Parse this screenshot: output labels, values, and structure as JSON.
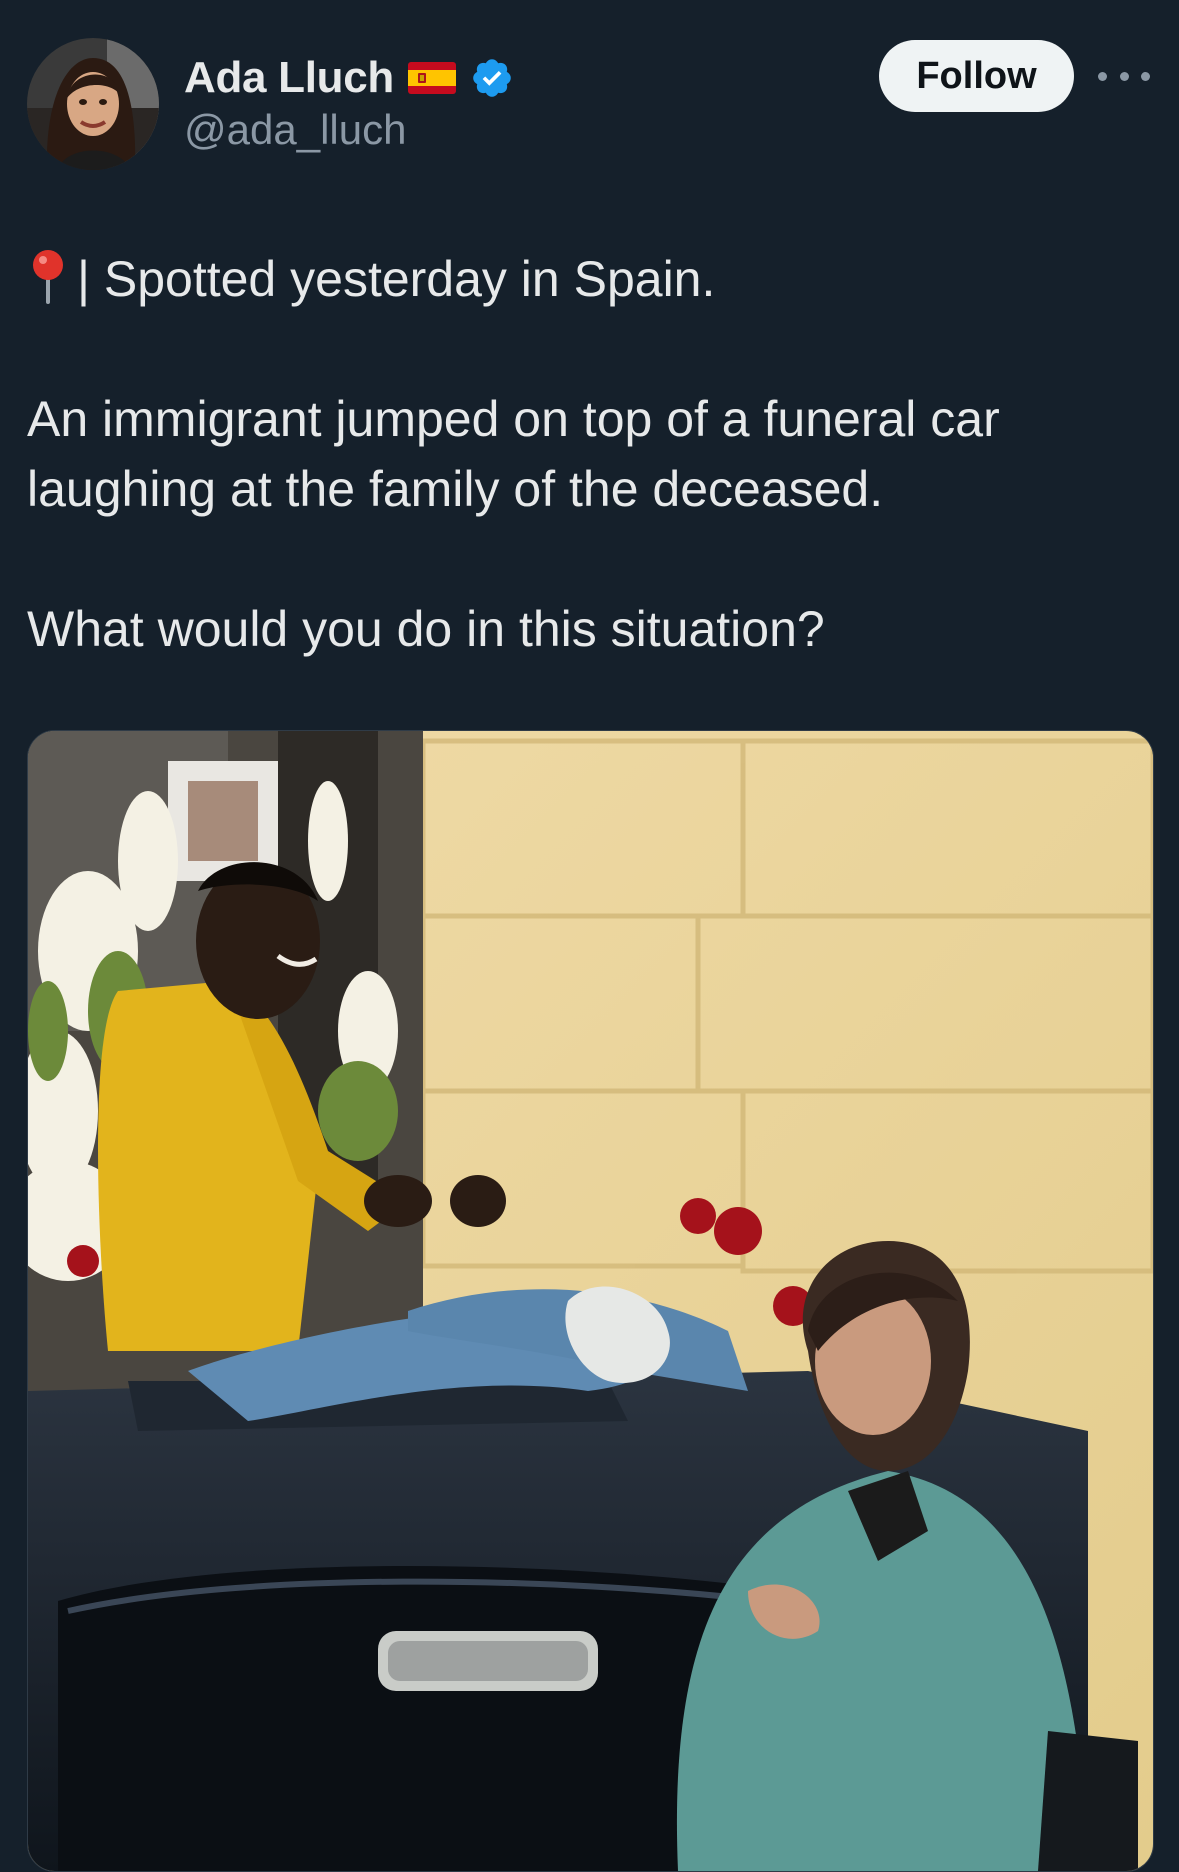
{
  "author": {
    "display_name": "Ada Lluch",
    "handle": "@ada_lluch",
    "flag_icon": "spain-flag-icon",
    "verified_icon": "verified-badge-icon",
    "verified_color": "#1d9bf0"
  },
  "header": {
    "follow_label": "Follow",
    "more_icon": "more-options-icon"
  },
  "tweet": {
    "pin_icon": "round-pushpin-icon",
    "line1": "| Spotted yesterday in Spain.",
    "line2": "An immigrant jumped on top of a funeral car",
    "line3": "laughing at the family of the deceased.",
    "line4": "What would you do in this situation?"
  },
  "theme": {
    "background": "#15202b",
    "text": "#e7e9ea",
    "muted": "#8b98a5"
  }
}
